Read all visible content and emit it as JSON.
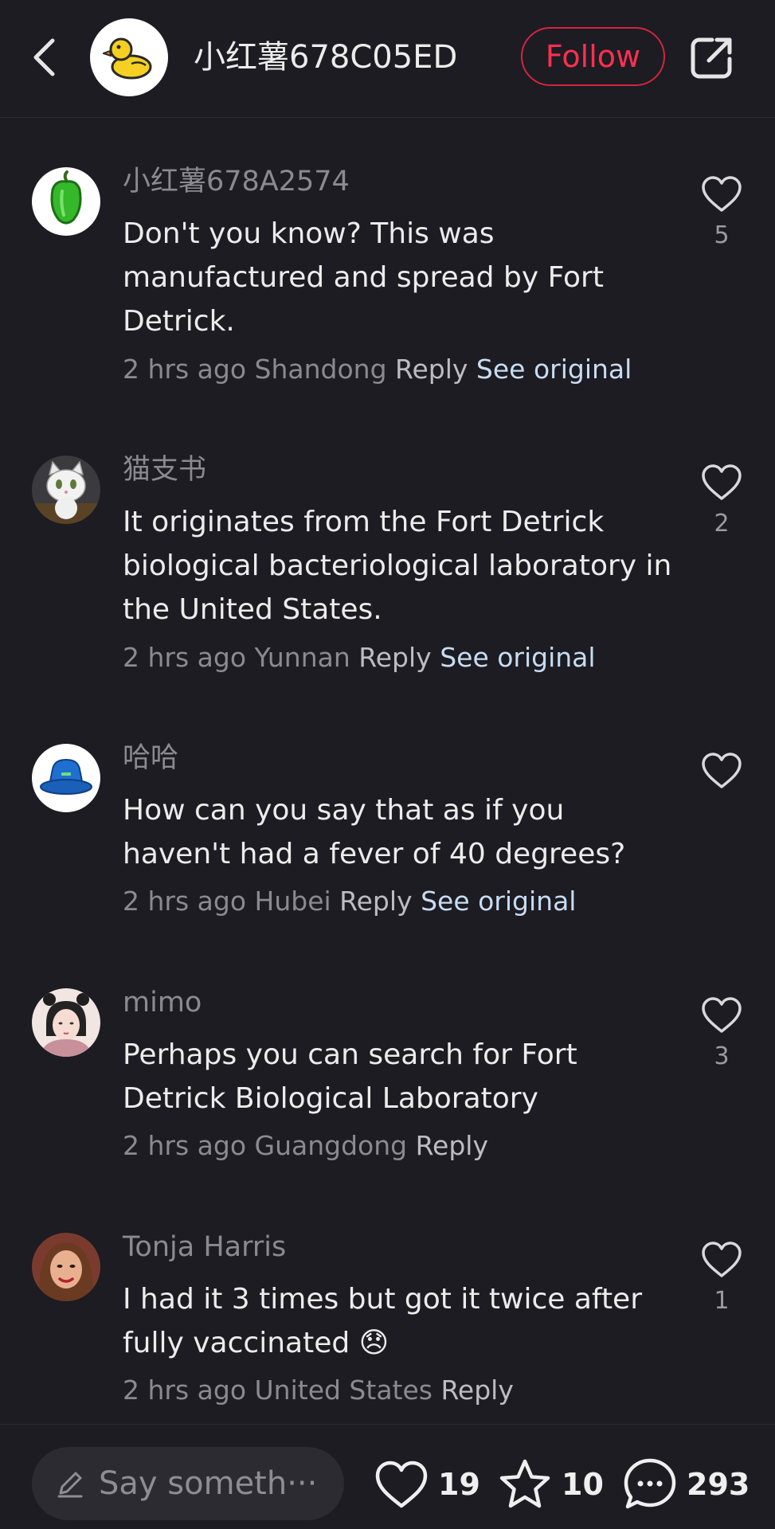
{
  "header": {
    "title": "小红薯678C05ED",
    "follow_label": "Follow"
  },
  "comments": [
    {
      "author": "小红薯678A2574",
      "text": "Don't you know? This was manufactured and spread by Fort Detrick.",
      "time": "2 hrs ago",
      "location": "Shandong",
      "reply_label": "Reply",
      "see_original_label": "See original",
      "likes": "5",
      "avatar_icon": "green-pepper-icon"
    },
    {
      "author": "猫支书",
      "text": "It originates from the Fort Detrick biological bacteriological laboratory in the United States.",
      "time": "2 hrs ago",
      "location": "Yunnan",
      "reply_label": "Reply",
      "see_original_label": "See original",
      "likes": "2",
      "avatar_icon": "cartoon-cat-icon"
    },
    {
      "author": "哈哈",
      "text": "How can you say that as if you haven't had a fever of 40 degrees?",
      "time": "2 hrs ago",
      "location": "Hubei",
      "reply_label": "Reply",
      "see_original_label": "See original",
      "likes": "",
      "avatar_icon": "blue-hat-icon"
    },
    {
      "author": "mimo",
      "text": "Perhaps you can search for Fort Detrick Biological Laboratory",
      "time": "2 hrs ago",
      "location": "Guangdong",
      "reply_label": "Reply",
      "likes": "3",
      "avatar_icon": "girl-portrait-icon"
    },
    {
      "author": "Tonja Harris",
      "text": "I had it 3 times but got it twice after fully vaccinated 😞",
      "time": "2 hrs ago",
      "location": "United States",
      "reply_label": "Reply",
      "likes": "1",
      "avatar_icon": "woman-portrait-icon"
    }
  ],
  "bottom_bar": {
    "input_placeholder": "Say someth···",
    "likes": "19",
    "stars": "10",
    "comments": "293"
  },
  "colors": {
    "background": "#1c1c22",
    "accent_follow": "#ff2f4f",
    "link": "#c8dcf2",
    "muted": "#8a8a90"
  }
}
